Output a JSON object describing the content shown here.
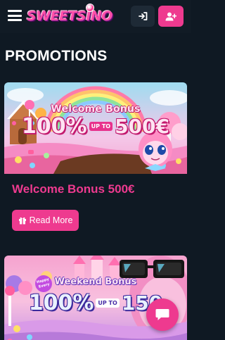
{
  "header": {
    "logo_text": "SWEETSINO",
    "login_icon": "sign-in-icon",
    "register_icon": "user-plus-icon",
    "accent_color": "#ee3a8f",
    "background_color": "#111b25"
  },
  "page": {
    "title": "PROMOTIONS"
  },
  "promotions": [
    {
      "banner_headline": "Welcome Bonus",
      "banner_percent": "100%",
      "banner_upto": "UP TO",
      "banner_amount": "500€",
      "title": "Welcome Bonus 500€",
      "button_label": "Read More",
      "button_icon": "gift-icon"
    },
    {
      "banner_badge": "Happy Every",
      "banner_headline": "Weekend Bonus",
      "banner_percent": "100%",
      "banner_upto": "UP TO",
      "banner_amount": "150"
    }
  ],
  "chat": {
    "icon": "chat-icon"
  }
}
